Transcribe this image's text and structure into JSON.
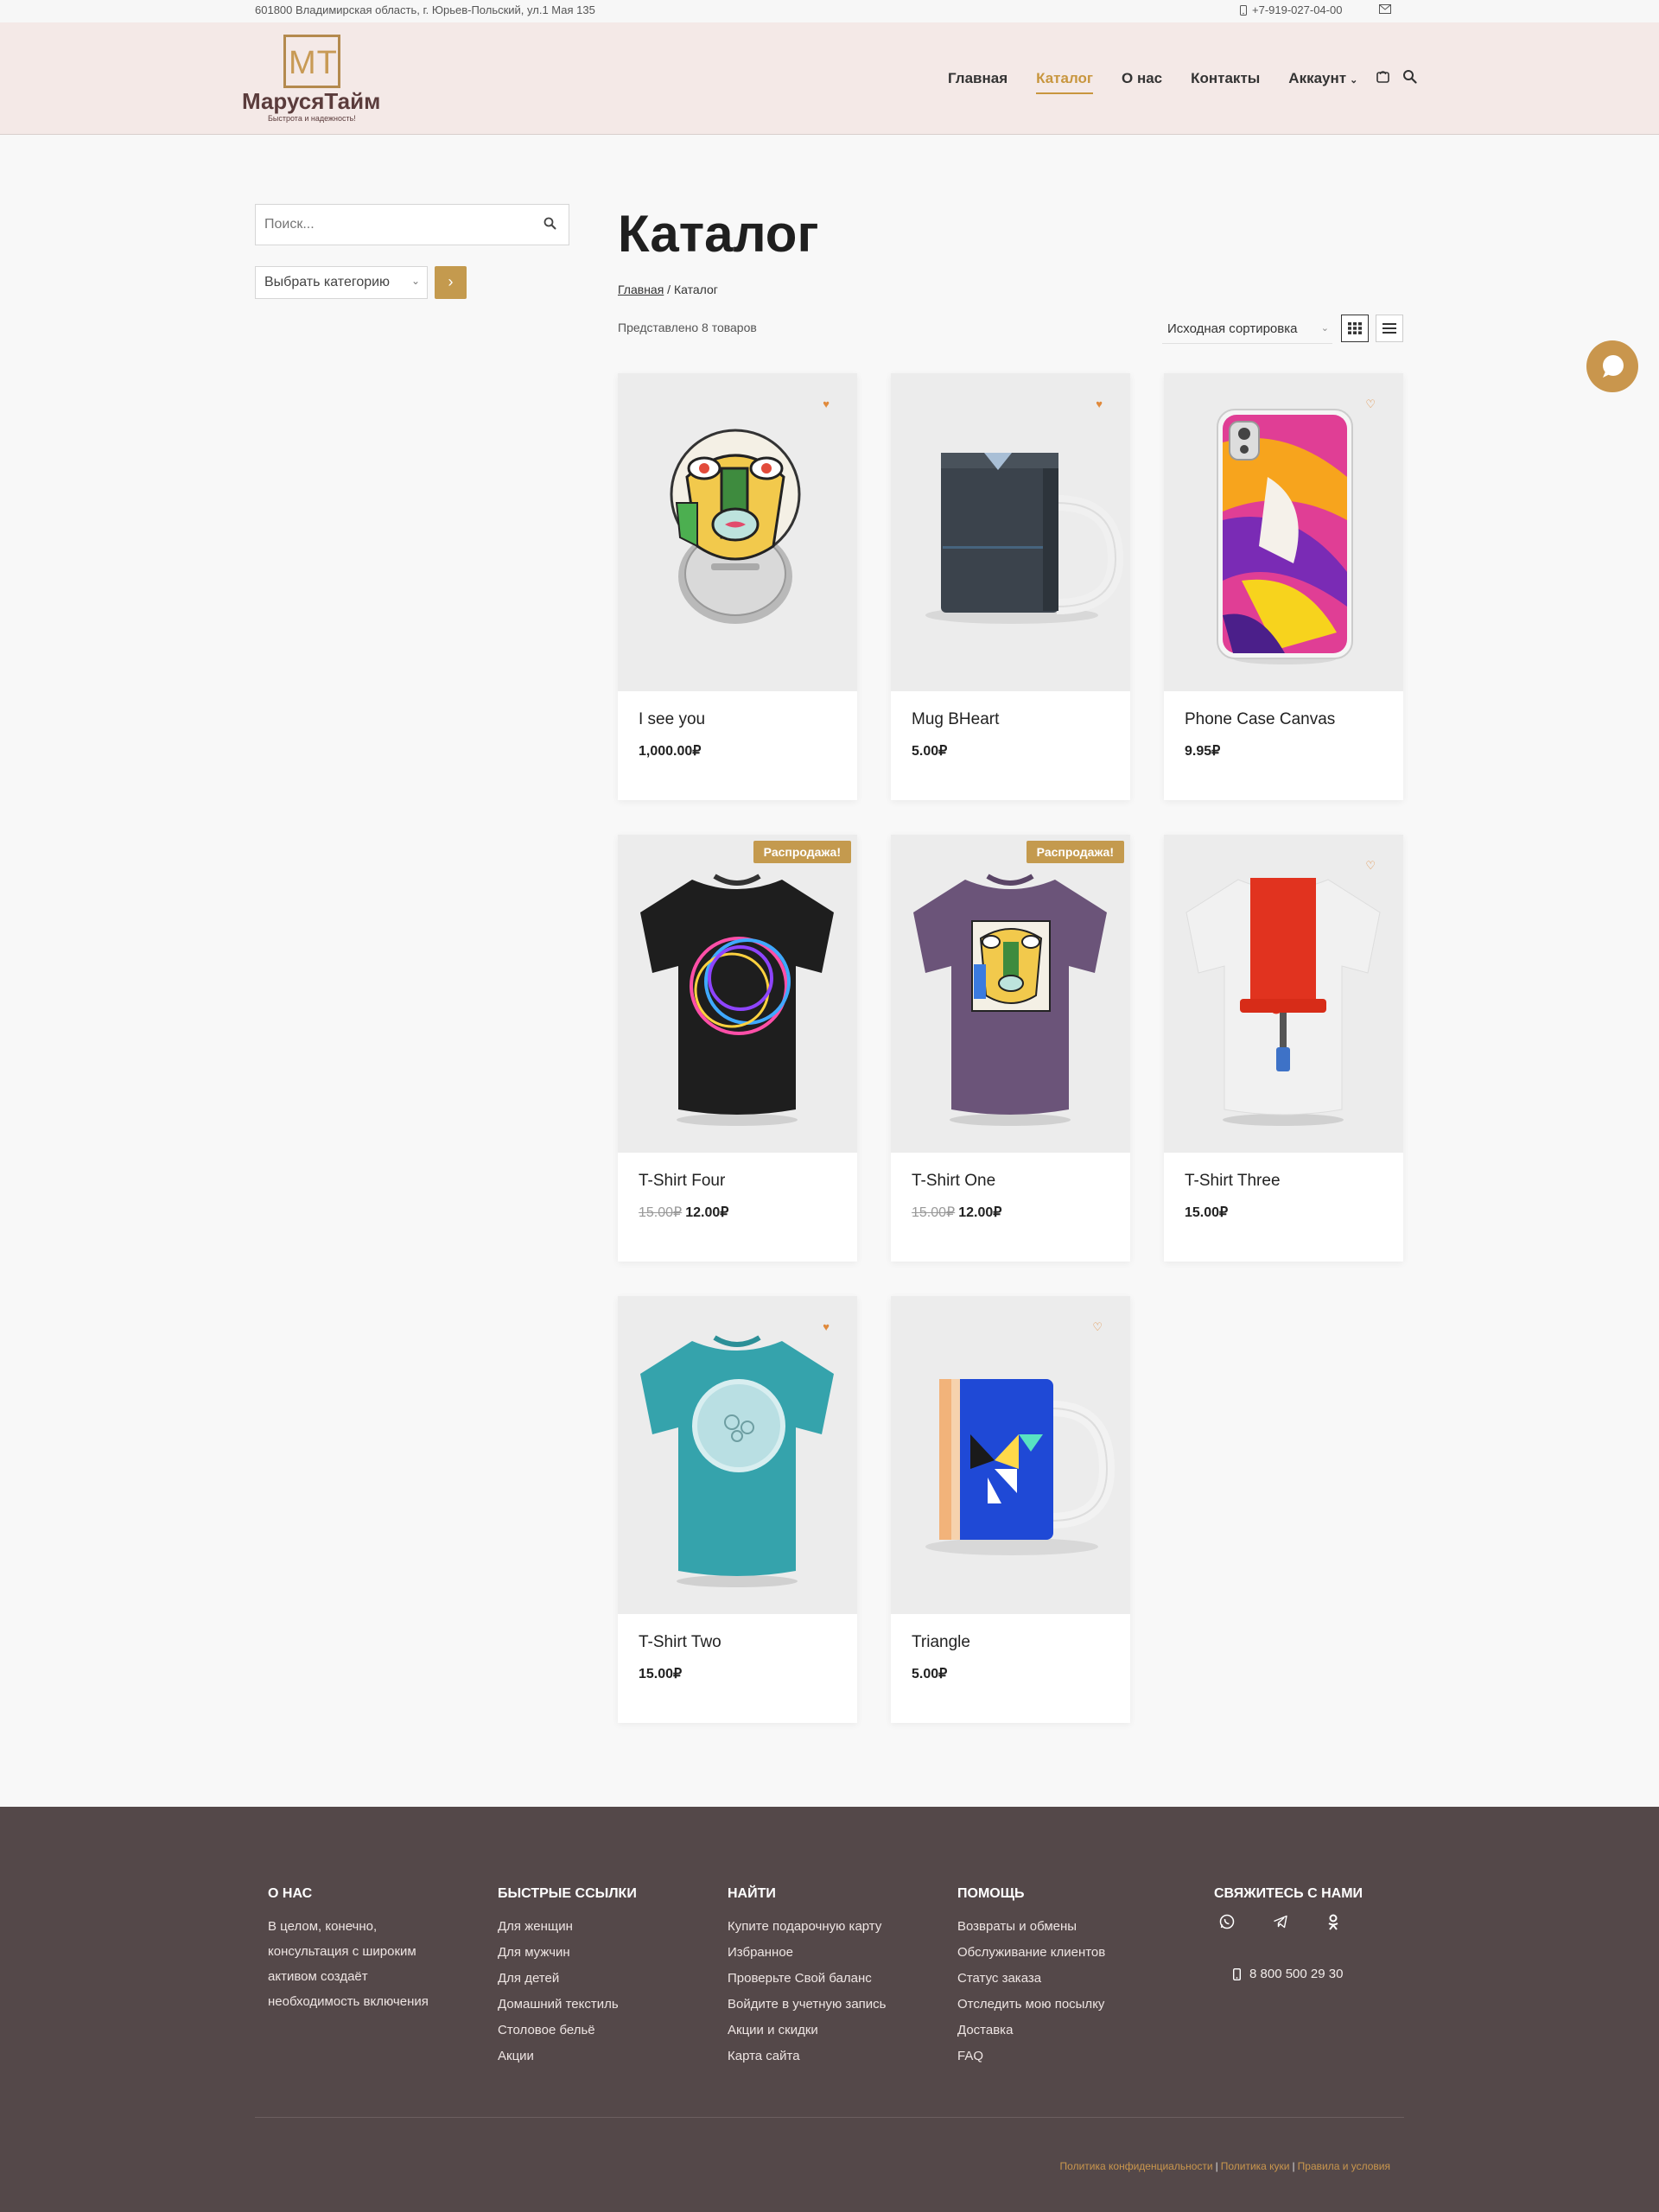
{
  "topbar": {
    "address": "601800 Владимирская область, г. Юрьев-Польский, ул.1 Мая 135",
    "phone": "+7-919-027-04-00"
  },
  "logo": {
    "mark": "MT",
    "name": "МарусяТайм",
    "slogan": "Быстрота и надежность!"
  },
  "nav": {
    "items": [
      "Главная",
      "Каталог",
      "О нас",
      "Контакты",
      "Аккаунт"
    ],
    "active": "Каталог"
  },
  "sidebar": {
    "search_placeholder": "Поиск...",
    "category_select": "Выбрать категорию"
  },
  "main": {
    "title": "Каталог",
    "breadcrumb_home": "Главная",
    "breadcrumb_sep": " / ",
    "breadcrumb_current": "Каталог",
    "result_count": "Представлено 8 товаров",
    "sort": "Исходная сортировка"
  },
  "products": [
    {
      "title": "I see you",
      "price": "1,000.00₽",
      "old_price": "",
      "sale": ""
    },
    {
      "title": "Mug BHeart",
      "price": "5.00₽",
      "old_price": "",
      "sale": ""
    },
    {
      "title": "Phone Case Canvas",
      "price": "9.95₽",
      "old_price": "",
      "sale": ""
    },
    {
      "title": "T-Shirt Four",
      "price": "12.00₽",
      "old_price": "15.00₽",
      "sale": "Распродажа!"
    },
    {
      "title": "T-Shirt One",
      "price": "12.00₽",
      "old_price": "15.00₽",
      "sale": "Распродажа!"
    },
    {
      "title": "T-Shirt Three",
      "price": "15.00₽",
      "old_price": "",
      "sale": ""
    },
    {
      "title": "T-Shirt Two",
      "price": "15.00₽",
      "old_price": "",
      "sale": ""
    },
    {
      "title": "Triangle",
      "price": "5.00₽",
      "old_price": "",
      "sale": ""
    }
  ],
  "footer": {
    "about": {
      "heading": "О нас",
      "text": "В целом, конечно, консультация с широким активом создаёт необходимость включения"
    },
    "quick": {
      "heading": "Быстрые ссылки",
      "links": [
        "Для женщин",
        "Для мужчин",
        "Для детей",
        "Домашний текстиль",
        "Столовое бельё",
        "Акции"
      ]
    },
    "find": {
      "heading": "Найти",
      "links": [
        "Купите подарочную карту",
        "Избранное",
        "Проверьте Свой баланс",
        "Войдите в учетную запись",
        "Акции и скидки",
        "Карта сайта"
      ]
    },
    "help": {
      "heading": "Помощь",
      "links": [
        "Возвраты и обмены",
        "Обслуживание клиентов",
        "Статус заказа",
        "Отследить мою посылку",
        "Доставка",
        "FAQ"
      ]
    },
    "contact": {
      "heading": "Свяжитесь с нами",
      "phone": "8 800 500 29 30"
    },
    "legal": [
      "Политика конфиденциальности",
      "Политика куки",
      "Правила и условия"
    ]
  },
  "colors": {
    "accent": "#c49a4e",
    "header_bg": "#f4e9e7",
    "footer_bg": "#544849"
  }
}
